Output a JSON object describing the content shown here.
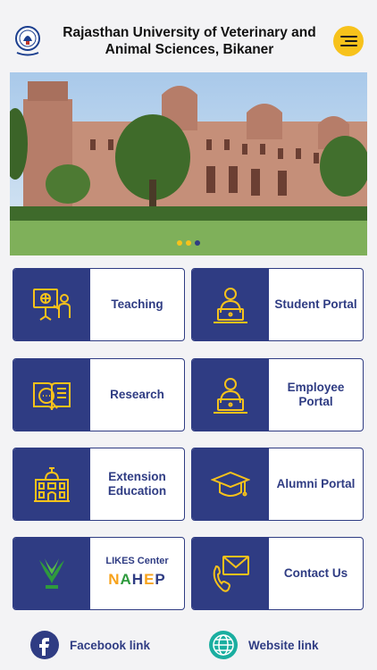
{
  "header": {
    "title": "Rajasthan University of Veterinary and Animal Sciences, Bikaner",
    "logo_icon": "university-seal-logo",
    "menu_icon": "hamburger-menu-icon"
  },
  "banner": {
    "image": "university-building-photo",
    "slides_count": 3,
    "active_slide": 2
  },
  "tiles": [
    {
      "label": "Teaching",
      "icon": "teacher-board-icon"
    },
    {
      "label": "Student Portal",
      "icon": "laptop-user-icon"
    },
    {
      "label": "Research",
      "icon": "book-search-icon"
    },
    {
      "label": "Employee Portal",
      "icon": "laptop-user-icon"
    },
    {
      "label": "Extension Education",
      "icon": "building-icon"
    },
    {
      "label": "Alumni Portal",
      "icon": "graduation-cap-icon"
    },
    {
      "label": "LIKES Center",
      "sub_label": "NAHEP",
      "icon": "icar-logo"
    },
    {
      "label": "Contact Us",
      "icon": "phone-mail-icon"
    }
  ],
  "social": {
    "facebook": {
      "label": "Facebook link",
      "icon": "facebook-icon"
    },
    "website": {
      "label": "Website link",
      "icon": "globe-icon"
    }
  },
  "colors": {
    "primary": "#2f3c83",
    "accent": "#f7c21b",
    "background": "#f3f3f5"
  }
}
